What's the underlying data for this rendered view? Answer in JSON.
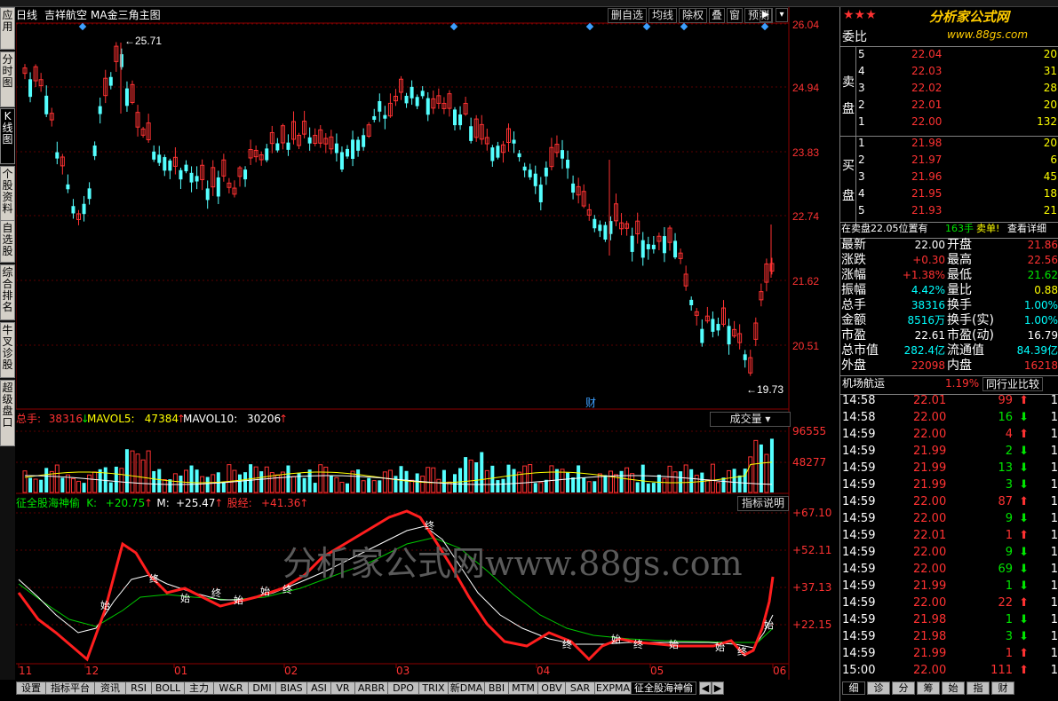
{
  "header": {
    "period": "日线",
    "stock_name": "吉祥航空",
    "indicator_title": "MA金三角主图",
    "buttons": [
      "删自选",
      "均线",
      "除权",
      "叠",
      "窗",
      "预测"
    ]
  },
  "left_tabs": [
    "应用",
    "分时图",
    "K线图",
    "个股资料",
    "自选股",
    "综合排名",
    "牛叉诊股",
    "超级盘口"
  ],
  "price_axis": [
    "26.04",
    "24.94",
    "23.83",
    "22.74",
    "21.62",
    "20.51"
  ],
  "price_markers": {
    "high": "25.71",
    "low": "19.73"
  },
  "volume_panel": {
    "label_total": "总手: ",
    "total": "38316",
    "mavol5_label": "MAVOL5: ",
    "mavol5": "47384",
    "mavol10_label": "MAVOL10: ",
    "mavol10": "30206",
    "dropdown": "成交量",
    "axis": [
      "96555",
      "48277"
    ]
  },
  "indicator_panel": {
    "name": "征全股海神偷",
    "k_label": "K: ",
    "k": "+20.75",
    "m_label": "M: ",
    "m": "+25.47",
    "stock_label": "股经: ",
    "stock": "+41.36",
    "help_button": "指标说明",
    "axis": [
      "+67.10",
      "+52.11",
      "+37.13",
      "+22.15"
    ],
    "watermark": "分析家公式网www.88gs.com",
    "mark_start": "始",
    "mark_end": "终"
  },
  "x_axis": [
    "11",
    "12",
    "01",
    "02",
    "03",
    "04",
    "05",
    "06"
  ],
  "fin_marker": "财",
  "bottom_tabs": [
    "设置",
    "指标平台",
    "资讯",
    "RSI",
    "BOLL",
    "主力",
    "W&R",
    "DMI",
    "BIAS",
    "ASI",
    "VR",
    "ARBR",
    "DPO",
    "TRIX",
    "新DMA",
    "BBI",
    "MTM",
    "OBV",
    "SAR",
    "EXPMA",
    "征全股海神偷"
  ],
  "right_panel": {
    "logo": "分析家公式网",
    "logo_url": "www.88gs.com",
    "wei_bi": "委比",
    "sell_label": "卖盘",
    "buy_label": "买盘",
    "asks": [
      {
        "level": "5",
        "price": "22.04",
        "vol": "20"
      },
      {
        "level": "4",
        "price": "22.03",
        "vol": "31"
      },
      {
        "level": "3",
        "price": "22.02",
        "vol": "28"
      },
      {
        "level": "2",
        "price": "22.01",
        "vol": "20"
      },
      {
        "level": "1",
        "price": "22.00",
        "vol": "132"
      }
    ],
    "bids": [
      {
        "level": "1",
        "price": "21.98",
        "vol": "20"
      },
      {
        "level": "2",
        "price": "21.97",
        "vol": "6"
      },
      {
        "level": "3",
        "price": "21.96",
        "vol": "45"
      },
      {
        "level": "4",
        "price": "21.95",
        "vol": "18"
      },
      {
        "level": "5",
        "price": "21.93",
        "vol": "21"
      }
    ],
    "status_line": {
      "prefix": "在卖盘22.05位置有",
      "lots": "163手",
      "suffix": "卖单!",
      "link": "查看详细"
    },
    "quote": [
      {
        "l1": "最新",
        "v1": "22.00",
        "l2": "开盘",
        "v2": "21.86"
      },
      {
        "l1": "涨跌",
        "v1": "+0.30",
        "l2": "最高",
        "v2": "22.56"
      },
      {
        "l1": "涨幅",
        "v1": "+1.38%",
        "l2": "最低",
        "v2": "21.62"
      },
      {
        "l1": "振幅",
        "v1": "4.42%",
        "l2": "量比",
        "v2": "0.88"
      },
      {
        "l1": "总手",
        "v1": "38316",
        "l2": "换手",
        "v2": "1.00%"
      },
      {
        "l1": "金额",
        "v1": "8516万",
        "l2": "换手(实)",
        "v2": "1.00%"
      },
      {
        "l1": "市盈",
        "v1": "22.61",
        "l2": "市盈(动)",
        "v2": "16.79"
      },
      {
        "l1": "总市值",
        "v1": "282.4亿",
        "l2": "流通值",
        "v2": "84.39亿"
      },
      {
        "l1": "外盘",
        "v1": "22098",
        "l2": "内盘",
        "v2": "16218"
      }
    ],
    "sector": {
      "name": "机场航运",
      "change": "1.19%",
      "compare": "同行业比较"
    },
    "ticks": [
      {
        "t": "14:58",
        "p": "22.01",
        "v": "99",
        "d": "up"
      },
      {
        "t": "14:58",
        "p": "22.00",
        "v": "16",
        "d": "down"
      },
      {
        "t": "14:59",
        "p": "22.00",
        "v": "4",
        "d": "up"
      },
      {
        "t": "14:59",
        "p": "21.99",
        "v": "2",
        "d": "down"
      },
      {
        "t": "14:59",
        "p": "21.99",
        "v": "13",
        "d": "down"
      },
      {
        "t": "14:59",
        "p": "21.99",
        "v": "3",
        "d": "down"
      },
      {
        "t": "14:59",
        "p": "22.00",
        "v": "87",
        "d": "up"
      },
      {
        "t": "14:59",
        "p": "22.00",
        "v": "9",
        "d": "down"
      },
      {
        "t": "14:59",
        "p": "22.01",
        "v": "1",
        "d": "up"
      },
      {
        "t": "14:59",
        "p": "22.00",
        "v": "9",
        "d": "down"
      },
      {
        "t": "14:59",
        "p": "22.00",
        "v": "69",
        "d": "down"
      },
      {
        "t": "14:59",
        "p": "21.99",
        "v": "1",
        "d": "down"
      },
      {
        "t": "14:59",
        "p": "22.00",
        "v": "22",
        "d": "up"
      },
      {
        "t": "14:59",
        "p": "21.98",
        "v": "1",
        "d": "down"
      },
      {
        "t": "14:59",
        "p": "21.98",
        "v": "3",
        "d": "down"
      },
      {
        "t": "14:59",
        "p": "21.99",
        "v": "1",
        "d": "up"
      },
      {
        "t": "15:00",
        "p": "22.00",
        "v": "111",
        "d": "up"
      }
    ],
    "bottom_tabs": [
      "细",
      "诊",
      "分",
      "筹",
      "始",
      "指",
      "财"
    ]
  },
  "chart_data": {
    "type": "candlestick",
    "x_months": [
      "11",
      "12",
      "01",
      "02",
      "03",
      "04",
      "05",
      "06"
    ],
    "price_range": [
      19.4,
      26.3
    ],
    "high": 25.71,
    "low": 19.73,
    "ylabels": [
      26.04,
      24.94,
      23.83,
      22.74,
      21.62,
      20.51
    ]
  }
}
